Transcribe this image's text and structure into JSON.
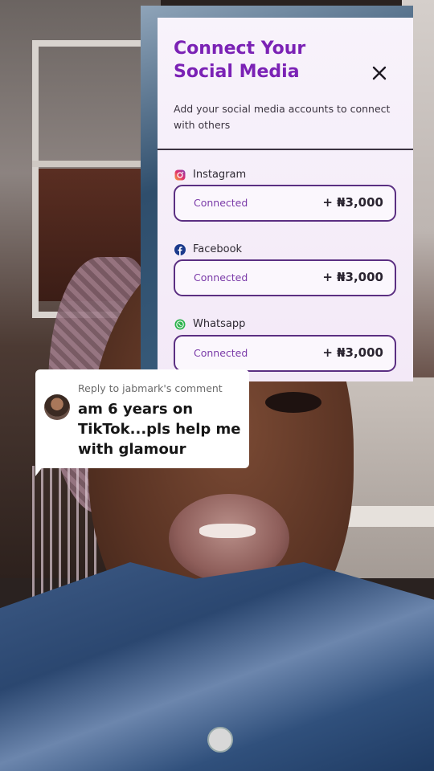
{
  "social_panel": {
    "title": "Connect Your Social Media",
    "subtitle": "Add your social media accounts to connect with others",
    "close_icon": "close-icon",
    "platforms": [
      {
        "name": "Instagram",
        "icon": "instagram-icon",
        "status": "Connected",
        "amount": "+ ₦3,000"
      },
      {
        "name": "Facebook",
        "icon": "facebook-icon",
        "status": "Connected",
        "amount": "+ ₦3,000"
      },
      {
        "name": "Whatsapp",
        "icon": "whatsapp-icon",
        "status": "Connected",
        "amount": "+ ₦3,000"
      }
    ],
    "colors": {
      "title": "#7b22b5",
      "border": "#5b2f82",
      "status": "#7a3aa8"
    }
  },
  "reply": {
    "header": "Reply to jabmark's comment",
    "text": "am 6 years on TikTok...pls help me with glamour",
    "avatar_icon": "avatar"
  }
}
